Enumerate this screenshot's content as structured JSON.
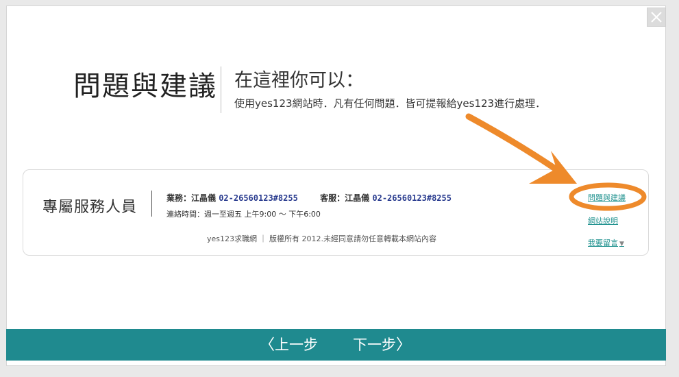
{
  "page": {
    "title": "問題與建議",
    "subtitle": "在這裡你可以：",
    "description": "使用yes123網站時．凡有任何問題．皆可提報給yes123進行處理．"
  },
  "footer": {
    "staff_label": "專屬服務人員",
    "business_label": "業務：江晶儀",
    "business_phone": "02-26560123#8255",
    "service_label": "客服：江晶儀",
    "service_phone": "02-26560123#8255",
    "hours": "連絡時間：週一至週五 上午9:00 ～ 下午6:00",
    "copyright": "yes123求職網 ｜ 版權所有 2012.未經同意請勿任意轉載本網站內容",
    "links": {
      "feedback": "問題與建議",
      "help": "網站說明",
      "message": "我要留言"
    }
  },
  "nav": {
    "prev": "上一步",
    "next": "下一步"
  },
  "colors": {
    "accent": "#1f8a8f",
    "link": "#20928f",
    "phone": "#2a3c8f",
    "annotation": "#ee8a2b"
  },
  "icons": {
    "close": "close-icon",
    "caret": "caret-down-icon",
    "prev": "chevron-left-icon",
    "next": "chevron-right-icon",
    "annotation": "arrow-annotation"
  }
}
